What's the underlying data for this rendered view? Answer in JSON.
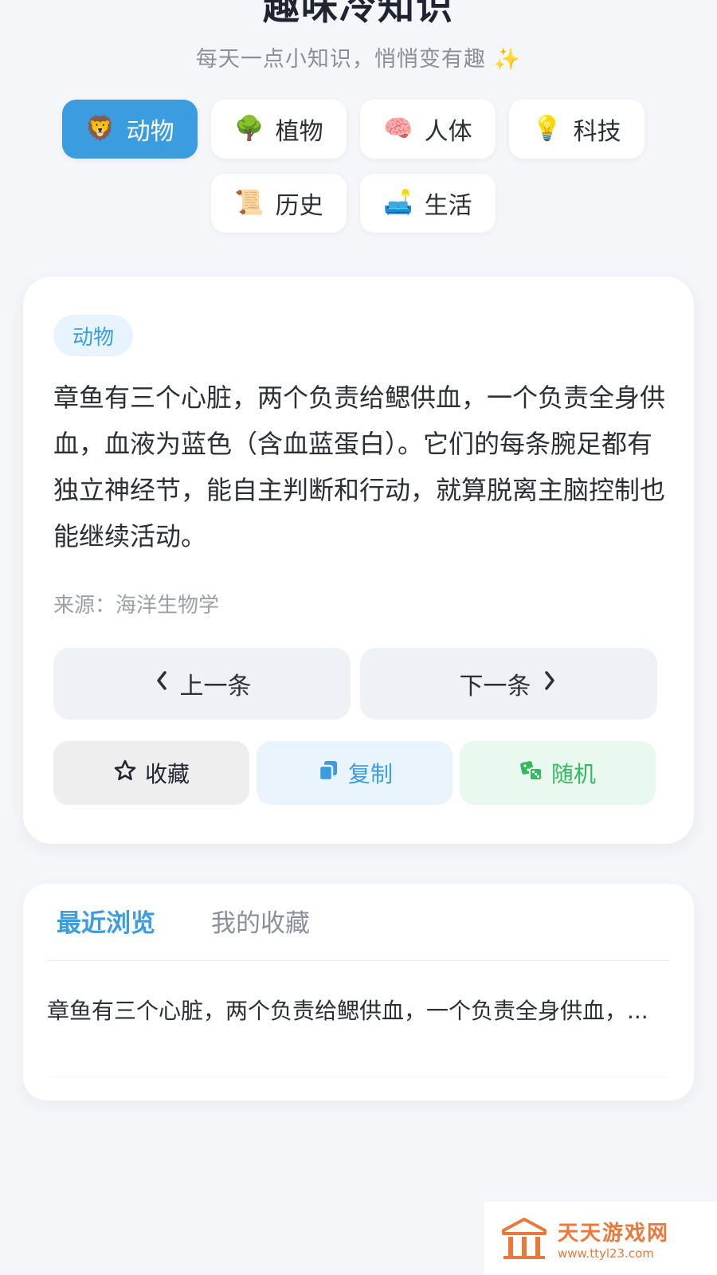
{
  "header": {
    "title": "趣味冷知识",
    "subtitle": "每天一点小知识，悄悄变有趣 ✨"
  },
  "categories": [
    {
      "emoji": "🦁",
      "label": "动物",
      "active": true
    },
    {
      "emoji": "🌳",
      "label": "植物",
      "active": false
    },
    {
      "emoji": "🧠",
      "label": "人体",
      "active": false
    },
    {
      "emoji": "💡",
      "label": "科技",
      "active": false
    },
    {
      "emoji": "📜",
      "label": "历史",
      "active": false
    },
    {
      "emoji": "🛋️",
      "label": "生活",
      "active": false
    }
  ],
  "card": {
    "tag": "动物",
    "fact": "章鱼有三个心脏，两个负责给鳃供血，一个负责全身供血，血液为蓝色（含血蓝蛋白）。它们的每条腕足都有独立神经节，能自主判断和行动，就算脱离主脑控制也能继续活动。",
    "source": "来源：海洋生物学",
    "prev_label": "上一条",
    "next_label": "下一条",
    "favorite_label": "收藏",
    "copy_label": "复制",
    "random_label": "随机"
  },
  "history": {
    "tabs": [
      {
        "label": "最近浏览",
        "active": true
      },
      {
        "label": "我的收藏",
        "active": false
      }
    ],
    "items": [
      "章鱼有三个心脏，两个负责给鳃供血，一个负责全身供血，..."
    ]
  },
  "watermark": {
    "name": "天天游戏网",
    "url": "www.ttyl23.com"
  },
  "colors": {
    "accent": "#3b9ce0",
    "background": "#f4f6f9",
    "random_green": "#34b860",
    "watermark_orange": "#e9783a"
  }
}
